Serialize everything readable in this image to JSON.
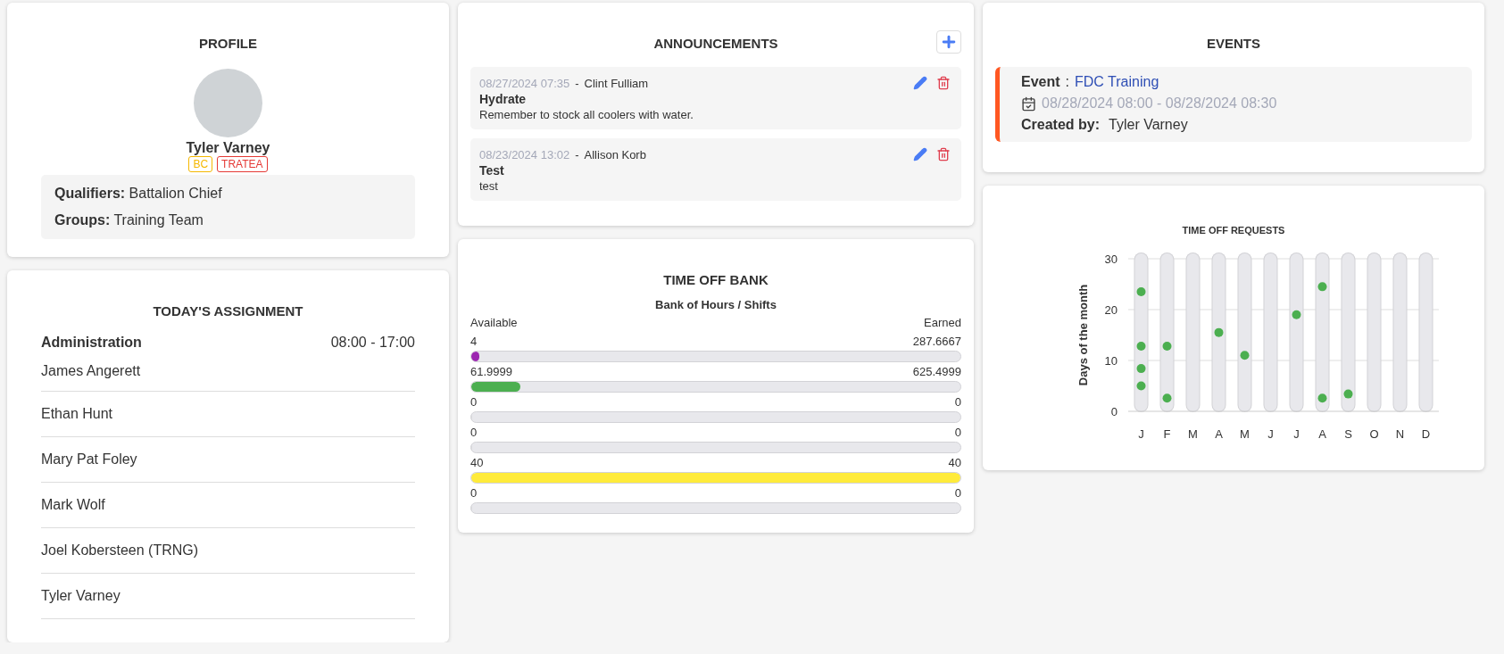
{
  "profile": {
    "title": "PROFILE",
    "name": "Tyler Varney",
    "tags": [
      {
        "label": "BC",
        "color": "#f5b800"
      },
      {
        "label": "TRATEA",
        "color": "#e53935"
      }
    ],
    "details": [
      {
        "label": "Qualifiers:",
        "value": "Battalion Chief"
      },
      {
        "label": "Groups:",
        "value": "Training Team"
      }
    ]
  },
  "assignment": {
    "title": "TODAY'S ASSIGNMENT",
    "unit": "Administration",
    "hours": "08:00 - 17:00",
    "people": [
      "James Angerett",
      "Ethan Hunt",
      "Mary Pat Foley",
      "Mark Wolf",
      "Joel Kobersteen (TRNG)",
      "Tyler Varney"
    ]
  },
  "announcements": {
    "title": "ANNOUNCEMENTS",
    "items": [
      {
        "date": "08/27/2024 07:35",
        "separator": "-",
        "author": "Clint Fulliam",
        "subject": "Hydrate",
        "body": "Remember to stock all coolers with water."
      },
      {
        "date": "08/23/2024 13:02",
        "separator": "-",
        "author": "Allison Korb",
        "subject": "Test",
        "body": "test"
      }
    ]
  },
  "time_off_bank": {
    "title": "TIME OFF BANK",
    "subtitle": "Bank of Hours / Shifts",
    "left_heading": "Available",
    "right_heading": "Earned",
    "rows": [
      {
        "available": "4",
        "earned": "287.6667",
        "level": 0.014,
        "color": "#9c27b0"
      },
      {
        "available": "61.9999",
        "earned": "625.4999",
        "level": 0.1,
        "color": "#4caf50"
      },
      {
        "available": "0",
        "earned": "0",
        "level": 0
      },
      {
        "available": "0",
        "earned": "0",
        "level": 0
      },
      {
        "available": "40",
        "earned": "40",
        "level": 1,
        "color": "#ffeb3b"
      },
      {
        "available": "0",
        "earned": "0",
        "level": 0
      }
    ]
  },
  "events": {
    "title": "EVENTS",
    "items": [
      {
        "event_label": "Event",
        "colon": ":",
        "name": "FDC Training",
        "time": "08/28/2024 08:00 - 08/28/2024 08:30",
        "created_label": "Created by:",
        "created_by": "Tyler Varney"
      }
    ]
  },
  "time_off_requests": {
    "chart_data": {
      "type": "scatter",
      "title": "TIME OFF REQUESTS",
      "ylabel": "Days of the month",
      "grid": true,
      "categories": [
        "J",
        "F",
        "M",
        "A",
        "M",
        "J",
        "J",
        "A",
        "S",
        "O",
        "N",
        "D"
      ],
      "ylim": [
        0,
        30
      ],
      "yticks": [
        0,
        10,
        20,
        30
      ],
      "series": [
        {
          "color": "#4caf50",
          "values": [
            23.5,
            12.8,
            null,
            15.5,
            11,
            null,
            19,
            24.5,
            3.4,
            null,
            null,
            null
          ]
        },
        {
          "color": "#4caf50",
          "values": [
            12.8,
            2.6,
            null,
            null,
            null,
            null,
            null,
            2.6,
            null,
            null,
            null,
            null
          ]
        },
        {
          "color": "#4caf50",
          "values": [
            8.4,
            null,
            null,
            null,
            null,
            null,
            null,
            null,
            null,
            null,
            null,
            null
          ]
        },
        {
          "color": "#4caf50",
          "values": [
            5,
            null,
            null,
            null,
            null,
            null,
            null,
            null,
            null,
            null,
            null,
            null
          ]
        }
      ]
    }
  }
}
